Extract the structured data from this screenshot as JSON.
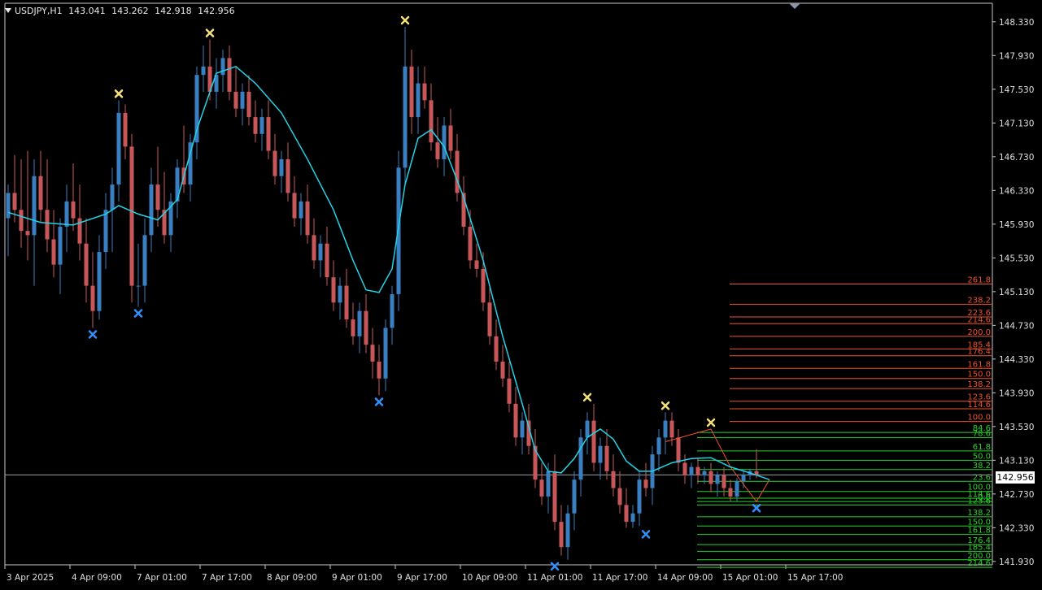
{
  "header": {
    "symbol": "USDJPY,H1",
    "open": "143.041",
    "high": "143.262",
    "low": "142.918",
    "close": "142.956"
  },
  "current_price": "142.956",
  "colors": {
    "background": "#000000",
    "bull": "#3a7fc1",
    "bear": "#c9575a",
    "ma_line": "#22d3e6",
    "swing_high": "#f2df7a",
    "swing_low": "#2e90ff",
    "fib_up": "#f0522a",
    "fib_down": "#2bd22b"
  },
  "icons": {
    "menu": "triangle-down-icon",
    "scroll_marker": "triangle-down-icon",
    "swing_high": "x-marker-icon",
    "swing_low": "x-marker-icon"
  },
  "chart_data": {
    "type": "candlestick",
    "y_ticks": [
      "148.330",
      "147.930",
      "147.530",
      "147.130",
      "146.730",
      "146.330",
      "145.930",
      "145.530",
      "145.130",
      "144.730",
      "144.330",
      "143.930",
      "143.530",
      "143.130",
      "142.730",
      "142.330",
      "141.930"
    ],
    "ylim": [
      141.89,
      148.55
    ],
    "x_ticks": [
      "3 Apr 2025",
      "4 Apr 09:00",
      "7 Apr 01:00",
      "7 Apr 17:00",
      "8 Apr 09:00",
      "9 Apr 01:00",
      "9 Apr 17:00",
      "10 Apr 09:00",
      "11 Apr 01:00",
      "11 Apr 17:00",
      "14 Apr 09:00",
      "15 Apr 01:00",
      "15 Apr 17:00"
    ],
    "swing_highs": [
      [
        17,
        147.4
      ],
      [
        31,
        148.12
      ],
      [
        61,
        148.27
      ],
      [
        89,
        143.8
      ],
      [
        101,
        143.7
      ],
      [
        108,
        143.5
      ]
    ],
    "swing_lows": [
      [
        13,
        144.7
      ],
      [
        20,
        144.95
      ],
      [
        57,
        143.9
      ],
      [
        84,
        141.95
      ],
      [
        98,
        142.33
      ],
      [
        115,
        142.64
      ]
    ],
    "ma_points": [
      [
        0,
        146.07
      ],
      [
        5,
        145.95
      ],
      [
        10,
        145.92
      ],
      [
        15,
        146.05
      ],
      [
        17,
        146.15
      ],
      [
        20,
        146.05
      ],
      [
        23,
        145.98
      ],
      [
        26,
        146.22
      ],
      [
        29,
        147.05
      ],
      [
        32,
        147.72
      ],
      [
        35,
        147.8
      ],
      [
        38,
        147.6
      ],
      [
        42,
        147.25
      ],
      [
        46,
        146.7
      ],
      [
        50,
        146.1
      ],
      [
        53,
        145.5
      ],
      [
        55,
        145.15
      ],
      [
        57,
        145.12
      ],
      [
        59,
        145.4
      ],
      [
        61,
        146.4
      ],
      [
        63,
        146.95
      ],
      [
        65,
        147.05
      ],
      [
        67,
        146.85
      ],
      [
        70,
        146.25
      ],
      [
        73,
        145.5
      ],
      [
        76,
        144.6
      ],
      [
        79,
        143.8
      ],
      [
        81,
        143.25
      ],
      [
        83,
        143.0
      ],
      [
        85,
        142.98
      ],
      [
        87,
        143.15
      ],
      [
        89,
        143.4
      ],
      [
        91,
        143.5
      ],
      [
        93,
        143.38
      ],
      [
        95,
        143.12
      ],
      [
        97,
        143.0
      ],
      [
        99,
        143.0
      ],
      [
        102,
        143.1
      ],
      [
        105,
        143.15
      ],
      [
        108,
        143.16
      ],
      [
        111,
        143.05
      ],
      [
        114,
        142.98
      ],
      [
        117,
        142.9
      ]
    ],
    "candles": [
      [
        146.0,
        146.3,
        145.7,
        145.55,
        146.4
      ],
      [
        146.3,
        146.1,
        146.6,
        145.95,
        146.75
      ],
      [
        146.1,
        145.85,
        146.55,
        145.65,
        146.7
      ],
      [
        145.85,
        145.8,
        146.5,
        145.5,
        146.8
      ],
      [
        145.8,
        146.5,
        145.3,
        145.2,
        146.7
      ],
      [
        146.5,
        146.1,
        146.6,
        145.95,
        146.8
      ],
      [
        146.1,
        145.75,
        146.4,
        145.6,
        146.7
      ],
      [
        145.75,
        145.45,
        145.9,
        145.3,
        146.1
      ],
      [
        145.45,
        145.9,
        145.2,
        145.1,
        146.0
      ],
      [
        145.9,
        146.2,
        145.7,
        145.6,
        146.4
      ],
      [
        146.2,
        146.0,
        146.5,
        145.85,
        146.65
      ],
      [
        146.0,
        145.7,
        146.2,
        145.5,
        146.4
      ],
      [
        145.7,
        145.2,
        145.9,
        145.0,
        146.0
      ],
      [
        145.2,
        144.9,
        145.5,
        144.7,
        145.6
      ],
      [
        144.9,
        145.6,
        144.85,
        144.8,
        145.8
      ],
      [
        145.6,
        146.1,
        145.5,
        145.4,
        146.3
      ],
      [
        146.1,
        146.4,
        145.7,
        145.6,
        146.6
      ],
      [
        146.4,
        147.25,
        146.3,
        146.2,
        147.4
      ],
      [
        147.25,
        146.85,
        147.3,
        146.7,
        147.35
      ],
      [
        146.85,
        145.2,
        146.9,
        145.0,
        147.0
      ],
      [
        145.2,
        145.2,
        145.5,
        144.95,
        145.7
      ],
      [
        145.2,
        145.8,
        145.1,
        145.0,
        146.0
      ],
      [
        145.8,
        146.4,
        145.7,
        145.6,
        146.6
      ],
      [
        146.4,
        146.1,
        146.7,
        145.9,
        146.85
      ],
      [
        146.1,
        145.8,
        146.4,
        145.7,
        146.55
      ],
      [
        145.8,
        146.2,
        145.7,
        145.6,
        146.3
      ],
      [
        146.2,
        146.6,
        146.1,
        146.0,
        146.7
      ],
      [
        146.6,
        146.4,
        147.0,
        146.3,
        147.1
      ],
      [
        146.4,
        146.9,
        146.3,
        146.2,
        147.0
      ],
      [
        146.9,
        147.7,
        146.8,
        146.7,
        147.8
      ],
      [
        147.7,
        147.8,
        148.0,
        147.5,
        148.05
      ],
      [
        147.8,
        147.5,
        147.85,
        147.4,
        148.12
      ],
      [
        147.5,
        147.7,
        147.4,
        147.3,
        147.9
      ],
      [
        147.7,
        147.9,
        147.6,
        147.5,
        148.0
      ],
      [
        147.9,
        147.5,
        148.0,
        147.4,
        148.05
      ],
      [
        147.5,
        147.3,
        147.7,
        147.2,
        147.8
      ],
      [
        147.3,
        147.5,
        147.2,
        147.1,
        147.6
      ],
      [
        147.5,
        147.2,
        147.6,
        147.1,
        147.7
      ],
      [
        147.2,
        147.0,
        147.3,
        146.9,
        147.4
      ],
      [
        147.0,
        147.2,
        146.9,
        146.8,
        147.3
      ],
      [
        147.2,
        146.8,
        147.3,
        146.7,
        147.4
      ],
      [
        146.8,
        146.5,
        146.9,
        146.4,
        147.0
      ],
      [
        146.5,
        146.7,
        146.4,
        146.3,
        146.8
      ],
      [
        146.7,
        146.3,
        146.8,
        146.2,
        146.9
      ],
      [
        146.3,
        146.0,
        146.4,
        145.9,
        146.5
      ],
      [
        146.0,
        146.2,
        145.9,
        145.8,
        146.3
      ],
      [
        146.2,
        145.8,
        146.3,
        145.7,
        146.4
      ],
      [
        145.8,
        145.5,
        145.9,
        145.4,
        146.0
      ],
      [
        145.5,
        145.7,
        145.4,
        145.3,
        145.8
      ],
      [
        145.7,
        145.3,
        145.8,
        145.2,
        145.9
      ],
      [
        145.3,
        145.0,
        145.4,
        144.9,
        145.5
      ],
      [
        145.0,
        145.2,
        144.9,
        144.8,
        145.3
      ],
      [
        145.2,
        144.8,
        145.3,
        144.7,
        145.4
      ],
      [
        144.8,
        144.6,
        144.9,
        144.5,
        145.0
      ],
      [
        144.6,
        144.9,
        144.5,
        144.4,
        145.0
      ],
      [
        144.9,
        144.5,
        145.0,
        144.4,
        145.1
      ],
      [
        144.5,
        144.3,
        144.6,
        144.1,
        144.7
      ],
      [
        144.3,
        144.1,
        144.4,
        143.9,
        144.5
      ],
      [
        144.1,
        144.7,
        144.0,
        143.95,
        144.8
      ],
      [
        144.7,
        145.1,
        144.6,
        144.5,
        145.2
      ],
      [
        145.1,
        146.6,
        145.0,
        144.9,
        146.8
      ],
      [
        146.6,
        147.8,
        146.5,
        146.4,
        148.27
      ],
      [
        147.8,
        147.2,
        147.9,
        147.0,
        148.0
      ],
      [
        147.2,
        147.6,
        147.1,
        147.0,
        147.8
      ],
      [
        147.6,
        147.4,
        147.7,
        147.3,
        147.8
      ],
      [
        147.4,
        146.9,
        147.5,
        146.8,
        147.6
      ],
      [
        146.9,
        146.7,
        147.0,
        146.6,
        147.2
      ],
      [
        146.7,
        147.1,
        146.6,
        146.5,
        147.2
      ],
      [
        147.1,
        146.8,
        147.2,
        146.7,
        147.3
      ],
      [
        146.8,
        146.3,
        146.9,
        146.2,
        147.0
      ],
      [
        146.3,
        145.9,
        146.4,
        145.8,
        146.5
      ],
      [
        145.9,
        145.5,
        146.0,
        145.4,
        146.1
      ],
      [
        145.5,
        145.4,
        145.6,
        145.3,
        145.7
      ],
      [
        145.4,
        145.0,
        145.5,
        144.9,
        145.6
      ],
      [
        145.0,
        144.6,
        145.1,
        144.5,
        145.2
      ],
      [
        144.6,
        144.3,
        144.7,
        144.2,
        144.8
      ],
      [
        144.3,
        144.1,
        144.4,
        144.0,
        144.5
      ],
      [
        144.1,
        143.8,
        144.2,
        143.7,
        144.3
      ],
      [
        143.8,
        143.4,
        143.9,
        143.3,
        144.0
      ],
      [
        143.4,
        143.6,
        143.3,
        143.2,
        143.7
      ],
      [
        143.6,
        143.3,
        143.7,
        143.2,
        143.8
      ],
      [
        143.3,
        142.9,
        143.4,
        142.8,
        143.5
      ],
      [
        142.9,
        142.7,
        143.0,
        142.6,
        143.1
      ],
      [
        142.7,
        143.0,
        142.6,
        142.5,
        143.1
      ],
      [
        143.0,
        142.4,
        143.1,
        142.3,
        143.2
      ],
      [
        142.4,
        142.1,
        142.5,
        142.0,
        142.6
      ],
      [
        142.1,
        142.5,
        142.0,
        141.95,
        142.6
      ],
      [
        142.5,
        142.9,
        142.4,
        142.3,
        143.0
      ],
      [
        142.9,
        143.4,
        142.8,
        142.7,
        143.5
      ],
      [
        143.4,
        143.6,
        143.3,
        143.2,
        143.7
      ],
      [
        143.6,
        143.1,
        143.7,
        143.0,
        143.8
      ],
      [
        143.1,
        143.3,
        143.0,
        142.9,
        143.4
      ],
      [
        143.3,
        143.0,
        143.4,
        142.9,
        143.5
      ],
      [
        143.0,
        142.8,
        143.1,
        142.7,
        143.2
      ],
      [
        142.8,
        142.6,
        142.9,
        142.5,
        143.0
      ],
      [
        142.6,
        142.4,
        142.7,
        142.33,
        142.8
      ],
      [
        142.4,
        142.5,
        142.35,
        142.33,
        142.6
      ],
      [
        142.5,
        142.9,
        142.4,
        142.35,
        143.0
      ],
      [
        142.9,
        142.8,
        143.0,
        142.7,
        143.1
      ],
      [
        142.8,
        143.2,
        142.7,
        142.6,
        143.3
      ],
      [
        143.2,
        143.4,
        143.1,
        143.0,
        143.5
      ],
      [
        143.4,
        143.6,
        143.3,
        143.2,
        143.7
      ],
      [
        143.6,
        143.4,
        143.65,
        143.3,
        143.7
      ],
      [
        143.4,
        143.1,
        143.45,
        143.0,
        143.5
      ],
      [
        143.1,
        142.95,
        143.15,
        142.85,
        143.2
      ],
      [
        142.95,
        143.05,
        142.9,
        142.8,
        143.1
      ],
      [
        143.05,
        142.95,
        143.1,
        142.85,
        143.15
      ],
      [
        142.95,
        143.0,
        142.9,
        142.85,
        143.05
      ],
      [
        143.0,
        142.85,
        143.05,
        142.75,
        143.1
      ],
      [
        142.85,
        142.95,
        142.8,
        142.7,
        143.0
      ],
      [
        142.95,
        142.8,
        143.0,
        142.7,
        143.05
      ],
      [
        142.8,
        142.7,
        142.85,
        142.64,
        142.9
      ],
      [
        142.7,
        142.88,
        142.65,
        142.64,
        142.92
      ],
      [
        142.88,
        142.956,
        142.85,
        142.8,
        143.0
      ],
      [
        142.956,
        143.0,
        142.92,
        142.9,
        143.03
      ],
      [
        143.0,
        142.956,
        143.04,
        142.918,
        143.262
      ]
    ],
    "fib_up": [
      [
        "261.8",
        145.22
      ],
      [
        "238.2",
        144.98
      ],
      [
        "223.6",
        144.83
      ],
      [
        "214.6",
        144.75
      ],
      [
        "200.0",
        144.6
      ],
      [
        "185.4",
        144.45
      ],
      [
        "176.4",
        144.37
      ],
      [
        "161.8",
        144.22
      ],
      [
        "150.0",
        144.1
      ],
      [
        "138.2",
        143.98
      ],
      [
        "123.6",
        143.83
      ],
      [
        "114.6",
        143.74
      ],
      [
        "100.0",
        143.59
      ]
    ],
    "fib_down": [
      [
        "84.6",
        143.46
      ],
      [
        "78.6",
        143.4
      ],
      [
        "61.8",
        143.24
      ],
      [
        "50.0",
        143.13
      ],
      [
        "38.2",
        143.02
      ],
      [
        "23.6",
        142.88
      ],
      [
        "0.0",
        142.64
      ],
      [
        "100.0",
        142.76
      ],
      [
        "114.6",
        142.68
      ],
      [
        "123.6",
        142.6
      ],
      [
        "138.2",
        142.46
      ],
      [
        "150.0",
        142.35
      ],
      [
        "161.8",
        142.25
      ],
      [
        "176.4",
        142.13
      ],
      [
        "185.4",
        142.05
      ],
      [
        "200.0",
        141.95
      ],
      [
        "214.6",
        141.86
      ]
    ]
  }
}
